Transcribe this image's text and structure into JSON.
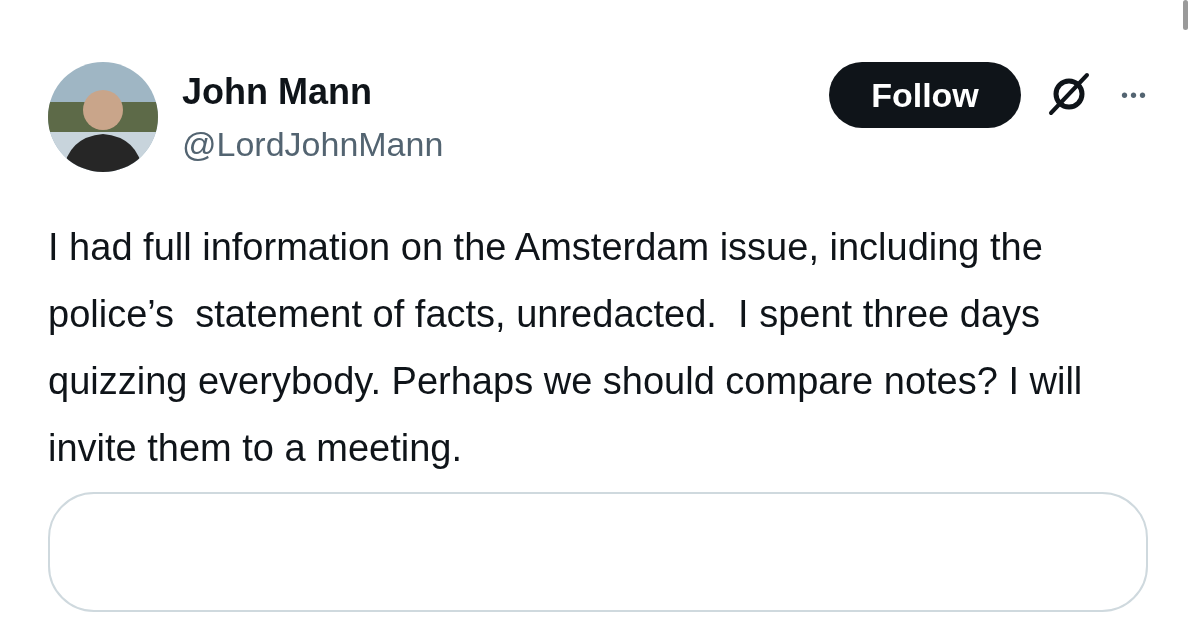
{
  "author": {
    "name": "John Mann",
    "handle": "@LordJohnMann"
  },
  "follow_button": {
    "label": "Follow"
  },
  "more_button": {
    "label": "•••"
  },
  "text": "I had full information on the Amsterdam issue, including the police’s  statement of facts, unredacted.  I spent three days quizzing everybody. Perhaps we should compare notes? I will invite them to a meeting."
}
